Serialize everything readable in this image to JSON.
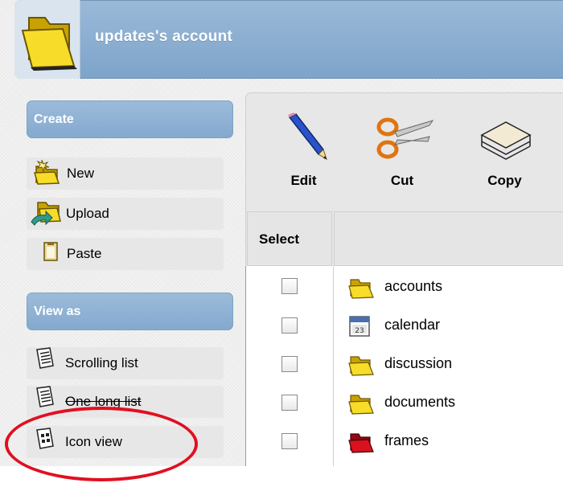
{
  "header": {
    "title": "updates's account",
    "icon": "folder-icon"
  },
  "sidebar": {
    "create": {
      "title": "Create",
      "items": [
        {
          "label": "New",
          "icon": "new-folder-icon"
        },
        {
          "label": "Upload",
          "icon": "upload-folder-icon"
        },
        {
          "label": "Paste",
          "icon": "paste-icon"
        }
      ]
    },
    "view_as": {
      "title": "View as",
      "items": [
        {
          "label": "Scrolling list",
          "icon": "list-icon"
        },
        {
          "label": "One long list",
          "icon": "list-icon"
        },
        {
          "label": "Icon view",
          "icon": "icon-view-icon"
        }
      ]
    }
  },
  "toolbar": {
    "edit_label": "Edit",
    "cut_label": "Cut",
    "copy_label": "Copy"
  },
  "table": {
    "select_header": "Select",
    "rows": [
      {
        "name": "accounts",
        "icon": "folder-icon"
      },
      {
        "name": "calendar",
        "icon": "calendar-icon"
      },
      {
        "name": "discussion",
        "icon": "folder-icon"
      },
      {
        "name": "documents",
        "icon": "folder-icon"
      },
      {
        "name": "frames",
        "icon": "red-folder-icon"
      }
    ]
  },
  "colors": {
    "accent": "#8aafd3",
    "annotation": "#e01020",
    "folder": "#f3d21a",
    "frames_folder": "#d8121e"
  }
}
